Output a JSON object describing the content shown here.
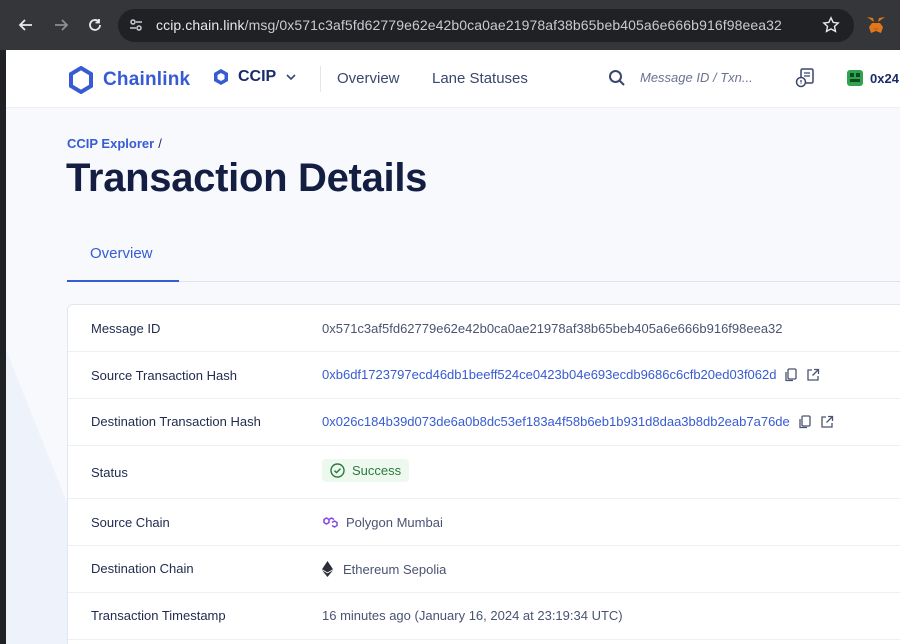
{
  "browser": {
    "url_host": "ccip.chain.link",
    "url_path": "/msg/0x571c3af5fd62779e62e42b0ca0ae21978af38b65beb405a6e666b916f98eea32"
  },
  "header": {
    "brand": "Chainlink",
    "product_selector": "CCIP",
    "nav": [
      "Overview",
      "Lane Statuses"
    ],
    "search_placeholder": "Message ID / Txn...",
    "wallet_label": "0x24"
  },
  "breadcrumb": {
    "root": "CCIP Explorer",
    "separator": "/"
  },
  "page_title": "Transaction Details",
  "tabs": [
    {
      "label": "Overview",
      "active": true
    }
  ],
  "details": {
    "message_id": {
      "label": "Message ID",
      "value": "0x571c3af5fd62779e62e42b0ca0ae21978af38b65beb405a6e666b916f98eea32"
    },
    "source_tx": {
      "label": "Source Transaction Hash",
      "value": "0xb6df1723797ecd46db1beeff524ce0423b04e693ecdb9686c6cfb20ed03f062d"
    },
    "dest_tx": {
      "label": "Destination Transaction Hash",
      "value": "0x026c184b39d073de6a0b8dc53ef183a4f58b6eb1b931d8daa3b8db2eab7a76de"
    },
    "status": {
      "label": "Status",
      "value": "Success"
    },
    "source_chain": {
      "label": "Source Chain",
      "value": "Polygon Mumbai"
    },
    "dest_chain": {
      "label": "Destination Chain",
      "value": "Ethereum Sepolia"
    },
    "timestamp": {
      "label": "Transaction Timestamp",
      "value": "16 minutes ago (January 16, 2024 at 23:19:34 UTC)"
    }
  },
  "colors": {
    "brand_blue": "#375bd2",
    "title_navy": "#131e42",
    "success_green": "#2b7a3e",
    "polygon_purple": "#8247e5"
  }
}
